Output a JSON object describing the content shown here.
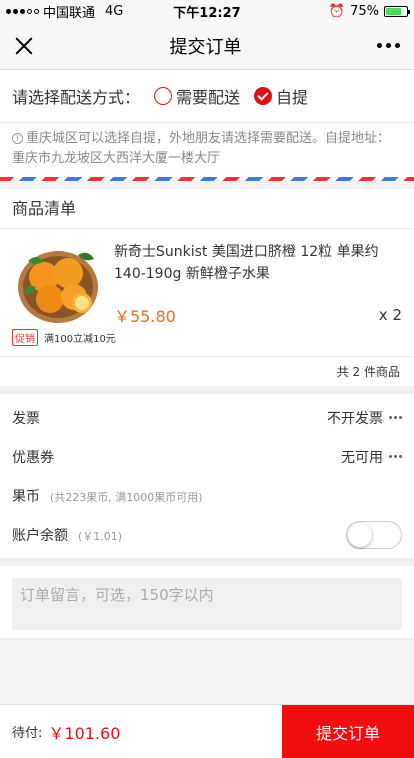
{
  "status_bar": {
    "carrier": "中国联通",
    "network": "4G",
    "time": "下午12:27",
    "battery": "75%"
  },
  "nav": {
    "title": "提交订单"
  },
  "delivery": {
    "label": "请选择配送方式：",
    "options": [
      {
        "label": "需要配送",
        "selected": false
      },
      {
        "label": "自提",
        "selected": true
      }
    ]
  },
  "notice": {
    "text": "重庆城区可以选择自提，外地朋友请选择需要配送。自提地址：重庆市九龙坡区大西洋大厦一楼大厅"
  },
  "products": {
    "title": "商品清单",
    "items": [
      {
        "name": "新奇士Sunkist 美国进口脐橙 12粒 单果约140-190g 新鲜橙子水果",
        "price": "￥55.80",
        "quantity": "x 2",
        "promo_tag": "促销",
        "promo_text": "满100立减10元"
      }
    ],
    "total_count": "共 2 件商品"
  },
  "options": {
    "invoice": {
      "label": "发票",
      "value": "不开发票"
    },
    "coupon": {
      "label": "优惠券",
      "value": "无可用"
    },
    "coins": {
      "label": "果币",
      "detail": "(共223果币, 满1000果币可用)"
    },
    "balance": {
      "label": "账户余额",
      "detail": "(￥1.01)",
      "enabled": false
    }
  },
  "remark": {
    "placeholder": "订单留言，可选，150字以内"
  },
  "footer": {
    "pay_label": "待付:",
    "amount": "￥101.60",
    "submit_label": "提交订单"
  },
  "colors": {
    "accent": "#f10e0e",
    "price": "#e96f21",
    "battery": "#4cd964"
  }
}
